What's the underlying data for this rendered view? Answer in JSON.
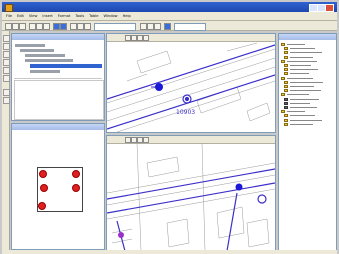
{
  "window": {
    "title": ""
  },
  "menu": [
    "File",
    "Edit",
    "View",
    "Insert",
    "Format",
    "Tools",
    "Table",
    "Window",
    "Help"
  ],
  "panels": {
    "tree_title": "",
    "doc_title": ""
  },
  "map_views": [
    {
      "name": "upper-map-view",
      "label": ""
    },
    {
      "name": "lower-map-view",
      "label": ""
    }
  ],
  "legend": {
    "title": "",
    "item_count": 20
  },
  "colors": {
    "title_bar": "#2152c0",
    "menu_bar": "#ece9d8",
    "feature_line": "#3c2fc9",
    "marker_red": "#e02020",
    "legend_swatch": "#f2cb3a",
    "selection": "#2f63d0"
  }
}
